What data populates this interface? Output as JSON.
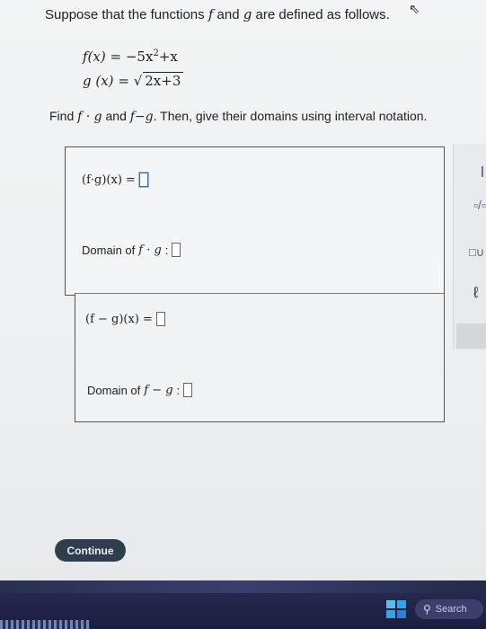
{
  "prompt": {
    "pre": "Suppose that the functions",
    "f": "f",
    "and": "and",
    "g": "g",
    "post": "are defined as follows."
  },
  "equations": {
    "f_lhs": "f(x)",
    "f_eq": "=",
    "f_rhs_a": "−5x",
    "f_exp": "2",
    "f_rhs_b": "+x",
    "g_lhs": "g (x)",
    "g_eq": "=",
    "g_radicand": "2x+3"
  },
  "instruction": {
    "find": "Find",
    "fg": "f · g",
    "and": "and",
    "fmg": "f−g",
    "rest": ". Then, give their domains using interval notation."
  },
  "answers": {
    "product_expr": "(f·g)(x)",
    "product_eq": "=",
    "domain_product_label": "Domain of",
    "domain_product_fn": "f · g",
    "colon": ":",
    "difference_expr": "(f − g)(x)",
    "difference_eq": "=",
    "domain_difference_label": "Domain of",
    "domain_difference_fn": "f − g"
  },
  "side_buttons": {
    "frac": "▫/▫",
    "interval": "□∪",
    "clear": "ℓ"
  },
  "continue_label": "Continue",
  "taskbar": {
    "search_label": "Search",
    "search_icon": "search-icon",
    "start_icon": "windows-start-icon"
  },
  "colors": {
    "continue_bg": "#2f3e4c",
    "taskbar_bg": "#1b1d40"
  }
}
